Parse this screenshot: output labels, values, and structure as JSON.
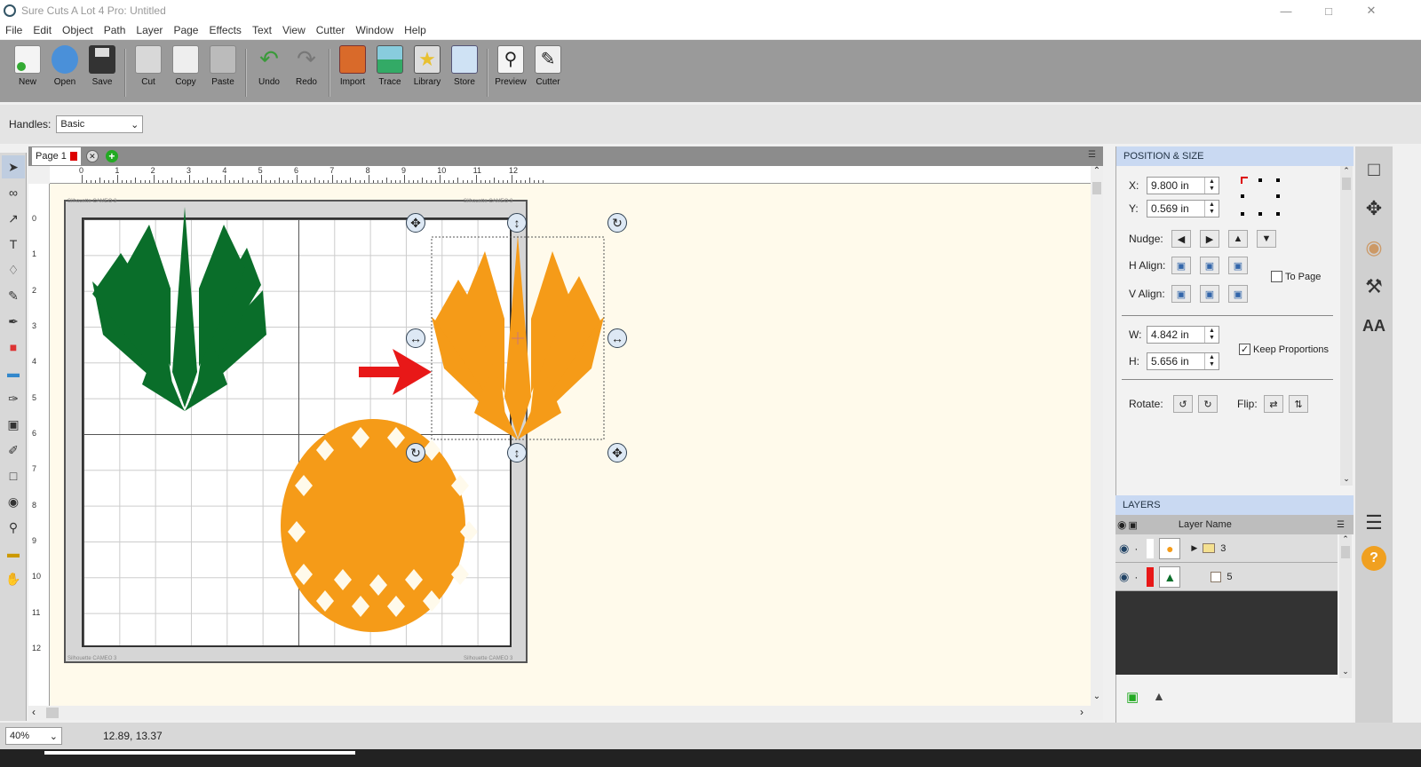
{
  "window": {
    "title": "Sure Cuts A Lot 4 Pro: Untitled"
  },
  "menu": [
    "File",
    "Edit",
    "Object",
    "Path",
    "Layer",
    "Page",
    "Effects",
    "Text",
    "View",
    "Cutter",
    "Window",
    "Help"
  ],
  "toolbar": {
    "groups": [
      [
        {
          "id": "new",
          "label": "New",
          "color": "#f4f4f4"
        },
        {
          "id": "open",
          "label": "Open",
          "color": "#4a90d9"
        },
        {
          "id": "save",
          "label": "Save",
          "color": "#333"
        }
      ],
      [
        {
          "id": "cut",
          "label": "Cut",
          "color": "#c8c8c8"
        },
        {
          "id": "copy",
          "label": "Copy",
          "color": "#eee"
        },
        {
          "id": "paste",
          "label": "Paste",
          "color": "#bbb"
        }
      ],
      [
        {
          "id": "undo",
          "label": "Undo",
          "color": "#4aa04a"
        },
        {
          "id": "redo",
          "label": "Redo",
          "color": "#888"
        }
      ],
      [
        {
          "id": "import",
          "label": "Import",
          "color": "#d96a2a"
        },
        {
          "id": "trace",
          "label": "Trace",
          "color": "#3aa36a"
        },
        {
          "id": "library",
          "label": "Library",
          "color": "#e8c030"
        },
        {
          "id": "store",
          "label": "Store",
          "color": "#5aa0d8"
        }
      ],
      [
        {
          "id": "preview",
          "label": "Preview",
          "color": "#f4f4f4"
        },
        {
          "id": "cutter",
          "label": "Cutter",
          "color": "#eee"
        }
      ]
    ]
  },
  "handles": {
    "label": "Handles:",
    "value": "Basic"
  },
  "page_tab": {
    "label": "Page 1"
  },
  "ruler": {
    "h": [
      "0",
      "1",
      "2",
      "3",
      "4",
      "5",
      "6",
      "7",
      "8",
      "9",
      "10",
      "11",
      "12"
    ],
    "v": [
      "0",
      "1",
      "2",
      "3",
      "4",
      "5",
      "6",
      "7",
      "8",
      "9",
      "10",
      "11",
      "12"
    ]
  },
  "mat": {
    "top_left": "Silhouette CAMEO 3",
    "top_right": "Silhouette CAMEO 3",
    "bottom_left": "Silhouette CAMEO 3",
    "bottom_right": "Silhouette CAMEO 3"
  },
  "colors": {
    "orange": "#f59b18",
    "green": "#0a6e2a",
    "arrow": "#e81818",
    "panel_header": "#c9d9f2",
    "toolbar": "#9a9a9a"
  },
  "position_size": {
    "header": "POSITION & SIZE",
    "x_label": "X:",
    "x_value": "9.800 in",
    "y_label": "Y:",
    "y_value": "0.569 in",
    "nudge_label": "Nudge:",
    "halign_label": "H Align:",
    "valign_label": "V Align:",
    "to_page_label": "To Page",
    "w_label": "W:",
    "w_value": "4.842 in",
    "h_label": "H:",
    "h_value": "5.656 in",
    "keep_proportions_label": "Keep Proportions",
    "keep_proportions_checked": true,
    "rotate_label": "Rotate:",
    "flip_label": "Flip:"
  },
  "layers": {
    "header": "LAYERS",
    "column": "Layer Name",
    "rows": [
      {
        "name": "3",
        "swatch": "#ffffff"
      },
      {
        "name": "5",
        "swatch": "#e81818"
      }
    ]
  },
  "status": {
    "zoom": "40%",
    "coords": "12.89, 13.37"
  }
}
